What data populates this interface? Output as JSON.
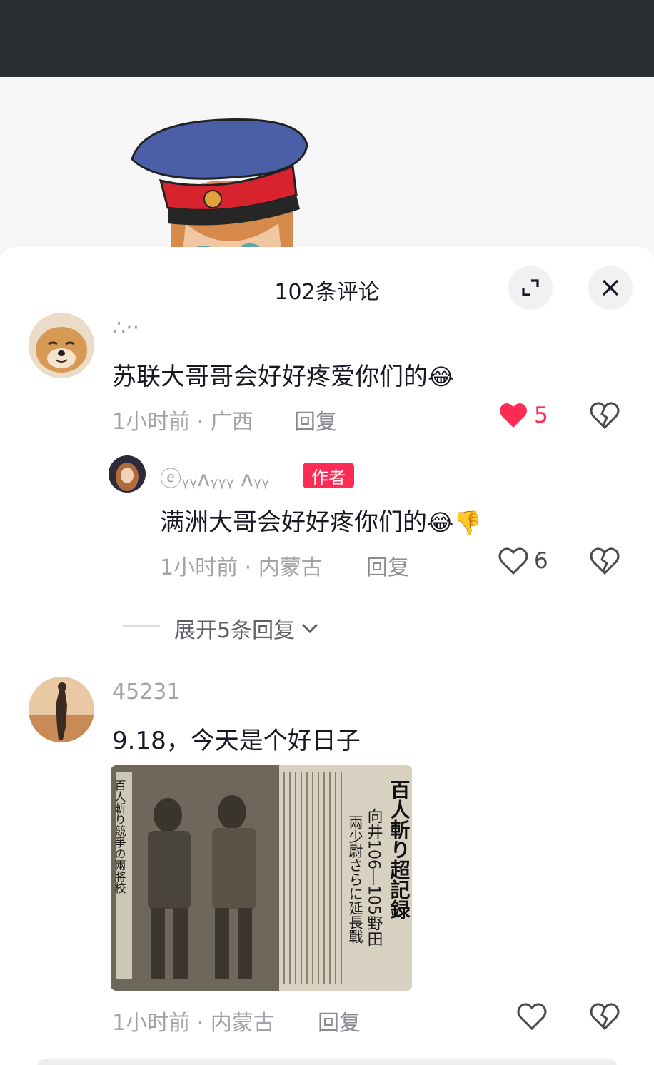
{
  "header": {
    "title": "102条评论"
  },
  "comments": [
    {
      "username": "∴··",
      "text": "苏联大哥哥会好好疼爱你们的",
      "emojis": [
        "😂"
      ],
      "time_location": "1小时前 · 广西",
      "reply_label": "回复",
      "like_count": "5",
      "liked": true
    },
    {
      "username": "ⓔᵧᵧᴧᵧᵧᵧ ᴧᵧᵧ",
      "author_tag": "作者",
      "text": "满洲大哥会好好疼你们的",
      "emojis": [
        "😂",
        "👎"
      ],
      "time_location": "1小时前 · 内蒙古",
      "reply_label": "回复",
      "like_count": "6",
      "liked": false
    },
    {
      "username": "45231",
      "text": "9.18，今天是个好日子",
      "time_location": "1小时前 · 内蒙古",
      "reply_label": "回复",
      "liked": false
    }
  ],
  "expand_replies": "展开5条回复",
  "news_image": {
    "headline": "百人斬り超記録",
    "sub1": "向井106―105野田",
    "sub2": "兩少尉さらに延長戰",
    "side": "百人斬り競爭の兩將校"
  },
  "colors": {
    "like_red": "#fe2c55",
    "text": "#161823",
    "muted": "#a2a3a8",
    "top_bar": "#2a2d31"
  }
}
